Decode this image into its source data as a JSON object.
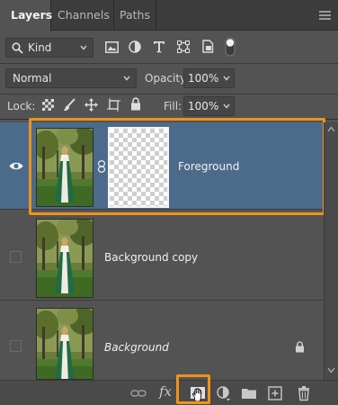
{
  "tabs": [
    {
      "label": "Layers",
      "active": true
    },
    {
      "label": "Channels",
      "active": false
    },
    {
      "label": "Paths",
      "active": false
    }
  ],
  "filter": {
    "kind_label": "Kind",
    "icons": [
      "image-filter-icon",
      "adjustment-filter-icon",
      "type-filter-icon",
      "shape-filter-icon",
      "smart-object-filter-icon",
      "filter-toggle-icon"
    ]
  },
  "blend": {
    "mode": "Normal",
    "opacity_label": "Opacity:",
    "opacity_value": "100%"
  },
  "lock": {
    "label": "Lock:",
    "icons": [
      "lock-transparent-icon",
      "lock-image-icon",
      "lock-position-icon",
      "lock-artboard-icon",
      "lock-all-icon"
    ],
    "fill_label": "Fill:",
    "fill_value": "100%"
  },
  "layers": [
    {
      "name": "Foreground",
      "visible": true,
      "selected": true,
      "has_mask": true,
      "italic": false,
      "locked": false
    },
    {
      "name": "Background copy",
      "visible": false,
      "selected": false,
      "has_mask": false,
      "italic": false,
      "locked": false
    },
    {
      "name": "Background",
      "visible": false,
      "selected": false,
      "has_mask": false,
      "italic": true,
      "locked": true
    }
  ],
  "bottom_icons": [
    "link-layers-icon",
    "fx-icon",
    "add-mask-icon",
    "adjustment-layer-icon",
    "new-group-icon",
    "new-layer-icon",
    "delete-icon"
  ],
  "bottom_fx_label": "fx",
  "colors": {
    "highlight": "#f0921a",
    "selected_row": "#4c6b8a",
    "panel": "#535353"
  }
}
